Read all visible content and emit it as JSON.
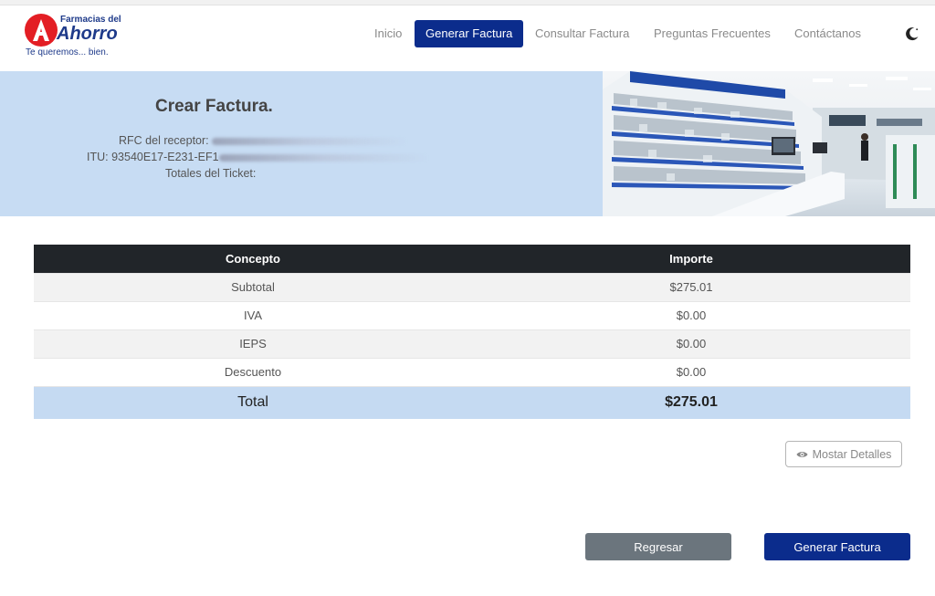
{
  "brand": {
    "name_top": "Farmacias del",
    "name_main": "Ahorro",
    "tagline": "Te queremos... bien."
  },
  "nav": {
    "items": [
      {
        "label": "Inicio"
      },
      {
        "label": "Generar Factura",
        "active": true
      },
      {
        "label": "Consultar Factura"
      },
      {
        "label": "Preguntas Frecuentes"
      },
      {
        "label": "Contáctanos"
      }
    ],
    "theme_icon": "moon-icon"
  },
  "banner": {
    "title": "Crear Factura.",
    "rfc_label": "RFC del receptor:",
    "itu_label": "ITU:",
    "itu_value": "93540E17-E231-EF1",
    "totals_label": "Totales del Ticket:"
  },
  "table": {
    "headers": [
      "Concepto",
      "Importe"
    ],
    "rows": [
      {
        "concepto": "Subtotal",
        "importe": "$275.01"
      },
      {
        "concepto": "IVA",
        "importe": "$0.00"
      },
      {
        "concepto": "IEPS",
        "importe": "$0.00"
      },
      {
        "concepto": "Descuento",
        "importe": "$0.00"
      }
    ],
    "total": {
      "concepto": "Total",
      "importe": "$275.01"
    }
  },
  "actions": {
    "details_label": "Mostar Detalles",
    "details_icon": "eye-icon",
    "back_label": "Regresar",
    "generate_label": "Generar Factura"
  },
  "colors": {
    "primary": "#0b2c8c",
    "banner_bg": "#c7dcf3",
    "table_header": "#212529",
    "total_row": "#c5daf2",
    "secondary_button": "#6b757d",
    "logo_red": "#e31e24"
  }
}
